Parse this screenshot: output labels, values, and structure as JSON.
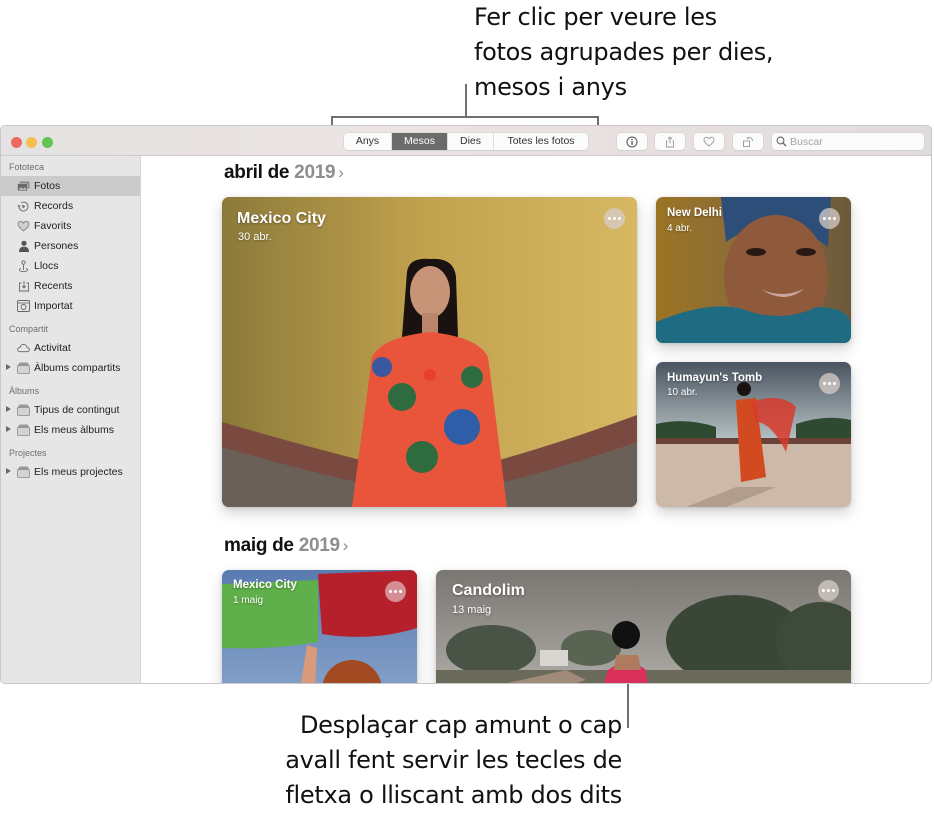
{
  "callouts": {
    "top": [
      "Fer clic per veure les",
      "fotos agrupades per dies,",
      "mesos i anys"
    ],
    "bottom": [
      "Desplaçar cap amunt o cap",
      "avall fent servir les tecles de",
      "fletxa o lliscant amb dos dits"
    ]
  },
  "toolbar": {
    "segments": [
      {
        "label": "Anys",
        "active": false
      },
      {
        "label": "Mesos",
        "active": true
      },
      {
        "label": "Dies",
        "active": false
      },
      {
        "label": "Totes les fotos",
        "active": false
      }
    ],
    "buttons": [
      {
        "icon": "info-icon"
      },
      {
        "icon": "share-icon"
      },
      {
        "icon": "heart-icon"
      },
      {
        "icon": "rotate-icon"
      }
    ],
    "search_placeholder": "Buscar",
    "search_value": ""
  },
  "sidebar": {
    "sections": [
      {
        "title": "Fototeca",
        "items": [
          {
            "label": "Fotos",
            "icon": "photos-icon",
            "selected": true
          },
          {
            "label": "Records",
            "icon": "memories-icon"
          },
          {
            "label": "Favorits",
            "icon": "heart-icon"
          },
          {
            "label": "Persones",
            "icon": "person-icon"
          },
          {
            "label": "Llocs",
            "icon": "pin-icon"
          },
          {
            "label": "Recents",
            "icon": "import-tray-icon"
          },
          {
            "label": "Importat",
            "icon": "camera-icon"
          }
        ]
      },
      {
        "title": "Compartit",
        "items": [
          {
            "label": "Activitat",
            "icon": "cloud-icon"
          },
          {
            "label": "Àlbums compartits",
            "icon": "folder-stack-icon",
            "disclosure": true
          }
        ]
      },
      {
        "title": "Àlbums",
        "items": [
          {
            "label": "Tipus de contingut",
            "icon": "folder-stack-icon",
            "disclosure": true
          },
          {
            "label": "Els meus àlbums",
            "icon": "folder-stack-icon",
            "disclosure": true
          }
        ]
      },
      {
        "title": "Projectes",
        "items": [
          {
            "label": "Els meus projectes",
            "icon": "folder-stack-icon",
            "disclosure": true
          }
        ]
      }
    ]
  },
  "months": [
    {
      "month": "abril de",
      "year": "2019",
      "chevron": "›",
      "cards": [
        {
          "title": "Mexico City",
          "date": "30 abr."
        },
        {
          "title": "New Delhi",
          "date": "4 abr."
        },
        {
          "title": "Humayun's Tomb",
          "date": "10 abr."
        }
      ]
    },
    {
      "month": "maig de",
      "year": "2019",
      "chevron": "›",
      "cards": [
        {
          "title": "Mexico City",
          "date": "1 maig"
        },
        {
          "title": "Candolim",
          "date": "13 maig"
        }
      ]
    }
  ]
}
